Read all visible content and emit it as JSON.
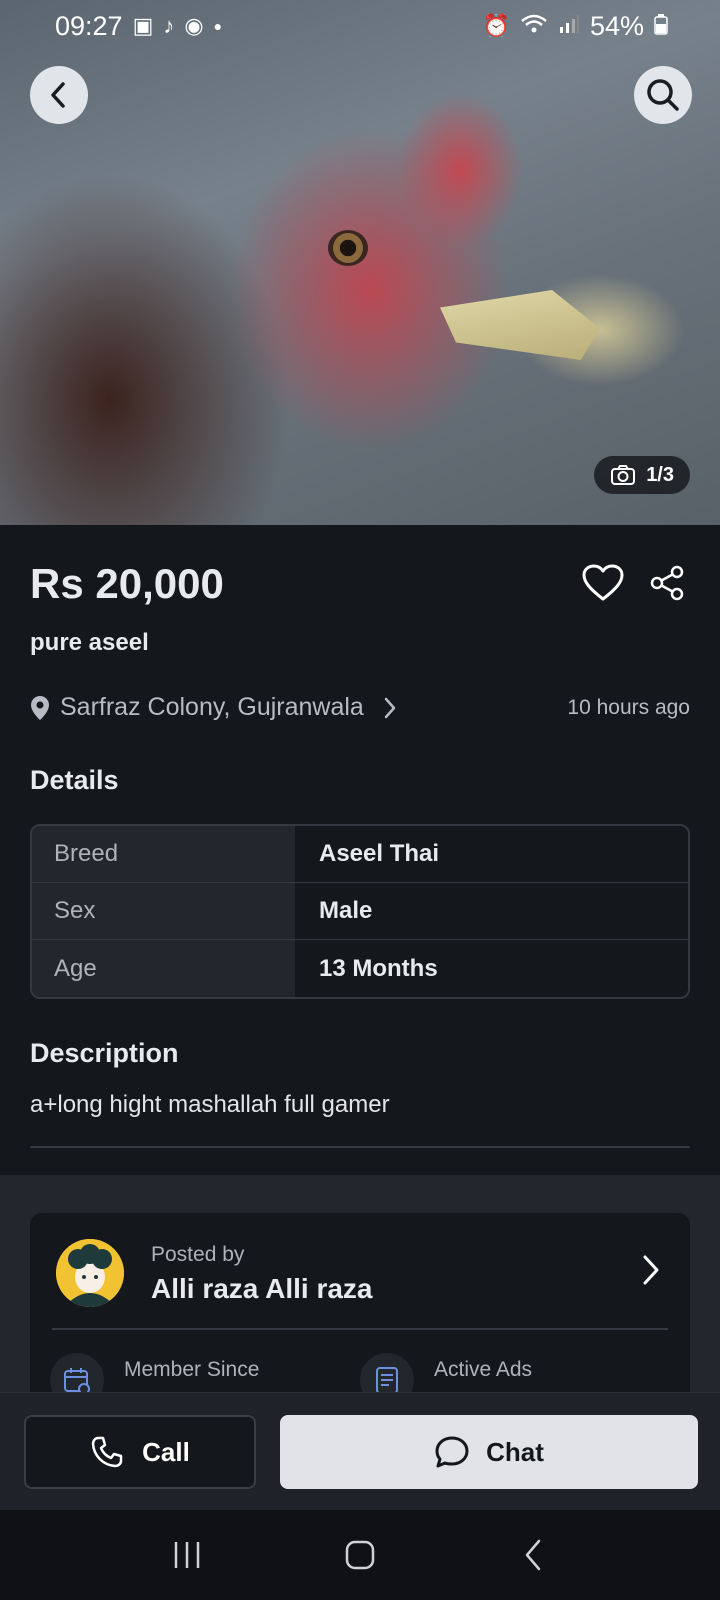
{
  "status_bar": {
    "time": "09:27",
    "battery": "54%",
    "left_icons": [
      "gallery-icon",
      "tiktok-icon",
      "app-icon",
      "dot-icon"
    ],
    "right_icons": [
      "alarm-icon",
      "wifi-icon",
      "signal-icon",
      "battery-icon"
    ]
  },
  "gallery": {
    "counter": "1/3"
  },
  "listing": {
    "price": "Rs 20,000",
    "title": "pure aseel",
    "location": "Sarfraz Colony, Gujranwala",
    "posted_time": "10 hours ago"
  },
  "details": {
    "heading": "Details",
    "rows": [
      {
        "key": "Breed",
        "value": "Aseel Thai"
      },
      {
        "key": "Sex",
        "value": "Male"
      },
      {
        "key": "Age",
        "value": "13 Months"
      }
    ]
  },
  "description": {
    "heading": "Description",
    "text": "a+long hight mashallah full gamer"
  },
  "seller": {
    "posted_by_label": "Posted by",
    "name": "Alli raza Alli raza",
    "member_since_label": "Member Since",
    "active_ads_label": "Active Ads"
  },
  "actions": {
    "call_label": "Call",
    "chat_label": "Chat"
  }
}
